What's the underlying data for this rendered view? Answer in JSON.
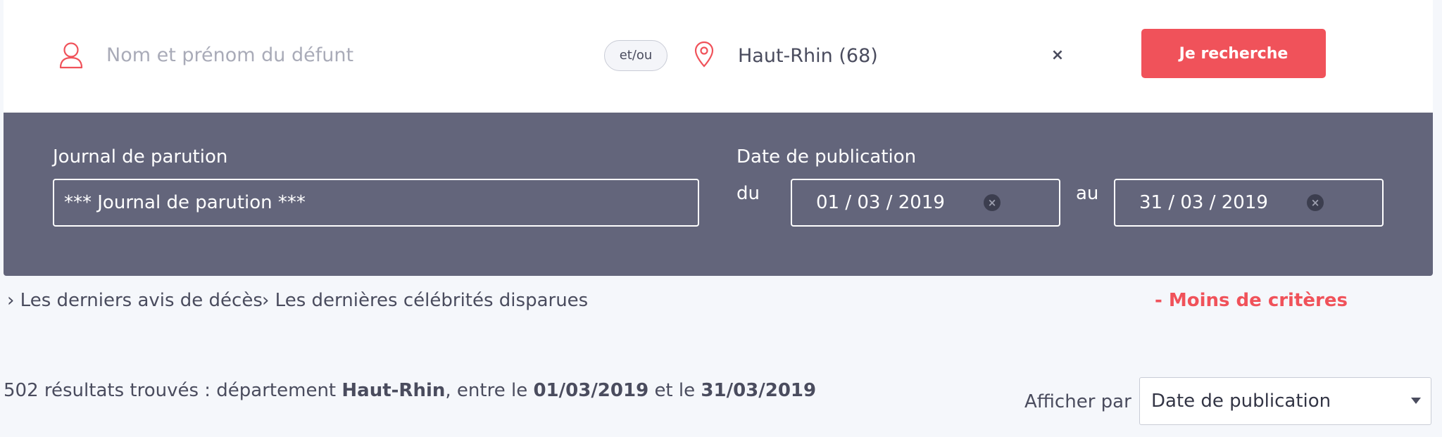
{
  "search": {
    "name_placeholder": "Nom et prénom du défunt",
    "name_value": "",
    "connector_label": "et/ou",
    "location_value": "Haut-Rhin (68)",
    "clear_location_symbol": "×",
    "submit_label": "Je recherche",
    "person_icon": "person-outline-icon",
    "location_icon": "map-pin-icon"
  },
  "criteria": {
    "journal_label": "Journal de parution",
    "journal_value": "*** Journal de parution ***",
    "date_label": "Date de publication",
    "from_label": "du",
    "from_date": "01 / 03 / 2019",
    "to_label": "au",
    "to_date": "31 / 03 / 2019",
    "clear_date_symbol": "×"
  },
  "links": {
    "latest_notices": "Les derniers avis de décès",
    "latest_celebrities": "Les dernières célébrités disparues",
    "chevron_symbol": "›",
    "less_criteria": "- Moins de critères"
  },
  "results": {
    "count_text": "502 résultats trouvés : département",
    "department": "Haut-Rhin",
    "between_text": ", entre le",
    "start_date": "01/03/2019",
    "and_text": "et le",
    "end_date": "31/03/2019"
  },
  "sort": {
    "label": "Afficher par",
    "selected": "Date de publication"
  },
  "colors": {
    "accent": "#f0525a",
    "panel": "#63657b",
    "text": "#4a4c5e",
    "background": "#f5f7fb"
  }
}
